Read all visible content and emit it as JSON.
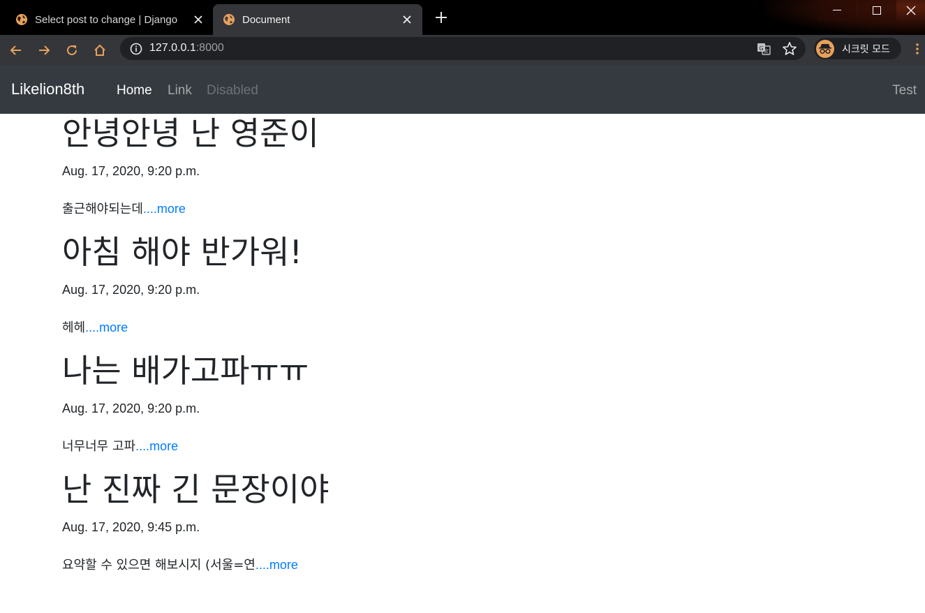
{
  "browser": {
    "tabs": [
      {
        "title": "Select post to change | Django",
        "active": false
      },
      {
        "title": "Document",
        "active": true
      }
    ],
    "url_host": "127.0.0.1",
    "url_port": ":8000",
    "incognito_label": "시크릿 모드"
  },
  "navbar": {
    "brand": "Likelion8th",
    "links": [
      {
        "label": "Home",
        "state": "active"
      },
      {
        "label": "Link",
        "state": "normal"
      },
      {
        "label": "Disabled",
        "state": "disabled"
      }
    ],
    "right_link": "Test"
  },
  "posts": [
    {
      "title": "안녕안녕 난 영준이",
      "date": "Aug. 17, 2020, 9:20 p.m.",
      "summary": "출근해야되는데",
      "more": "....more"
    },
    {
      "title": "아침 해야 반가워!",
      "date": "Aug. 17, 2020, 9:20 p.m.",
      "summary": "헤헤",
      "more": "....more"
    },
    {
      "title": "나는 배가고파ㅠㅠ",
      "date": "Aug. 17, 2020, 9:20 p.m.",
      "summary": "너무너무 고파",
      "more": "....more"
    },
    {
      "title": "난 진짜 긴 문장이야",
      "date": "Aug. 17, 2020, 9:45 p.m.",
      "summary": "요약할 수 있으면 해보시지 (서울=연",
      "more": "....more"
    }
  ],
  "colors": {
    "navbar": "#343a40",
    "link": "#007bff",
    "chrome_toolbar": "#35363a",
    "accent_orange": "#e8a15b"
  }
}
